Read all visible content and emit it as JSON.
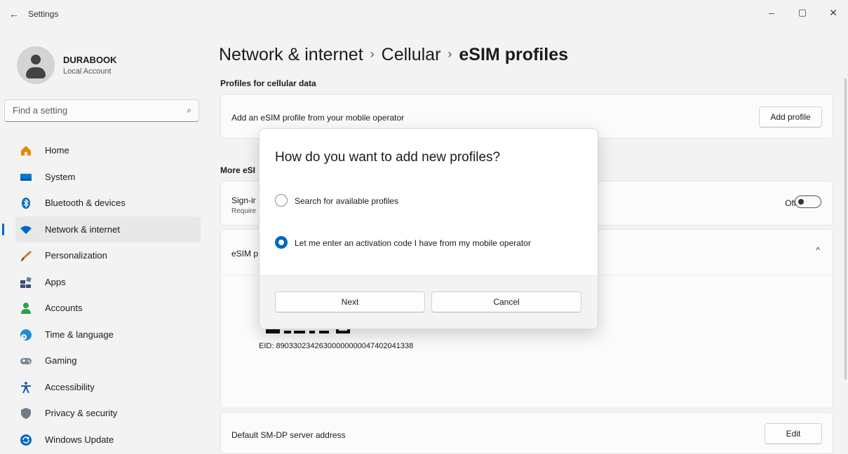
{
  "window": {
    "title": "Settings",
    "controls": [
      "–",
      "▢",
      "✕"
    ]
  },
  "account": {
    "name": "DURABOOK",
    "type": "Local Account"
  },
  "search": {
    "placeholder": "Find a setting"
  },
  "nav": {
    "items": [
      {
        "label": "Home",
        "icon": "home-icon",
        "color": "#e08a00",
        "active": false
      },
      {
        "label": "System",
        "icon": "system-icon",
        "color": "#0078d4",
        "active": false
      },
      {
        "label": "Bluetooth & devices",
        "icon": "bluetooth-icon",
        "color": "#0067c0",
        "active": false
      },
      {
        "label": "Network & internet",
        "icon": "wifi-icon",
        "color": "#0067c0",
        "active": true
      },
      {
        "label": "Personalization",
        "icon": "brush-icon",
        "color": "#c87a2a",
        "active": false
      },
      {
        "label": "Apps",
        "icon": "apps-icon",
        "color": "#3b4f6b",
        "active": false
      },
      {
        "label": "Accounts",
        "icon": "accounts-icon",
        "color": "#2ea043",
        "active": false
      },
      {
        "label": "Time & language",
        "icon": "globe-clock-icon",
        "color": "#1f8dd6",
        "active": false
      },
      {
        "label": "Gaming",
        "icon": "controller-icon",
        "color": "#7a8899",
        "active": false
      },
      {
        "label": "Accessibility",
        "icon": "accessibility-icon",
        "color": "#1a5fb4",
        "active": false
      },
      {
        "label": "Privacy & security",
        "icon": "shield-icon",
        "color": "#6f7b88",
        "active": false
      },
      {
        "label": "Windows Update",
        "icon": "update-icon",
        "color": "#0067c0",
        "active": false
      }
    ]
  },
  "breadcrumb": {
    "part1": "Network & internet",
    "part2": "Cellular",
    "current": "eSIM profiles",
    "separator": "›"
  },
  "main": {
    "profiles_section": "Profiles for cellular data",
    "add_profile_text": "Add an eSIM profile from your mobile operator",
    "add_profile_button": "Add profile",
    "more_section": "More eSI",
    "signin_title": "Sign-ir",
    "signin_sub": "Require",
    "toggle_state": "Off",
    "esim_card_title": "eSIM p",
    "eid": "EID: 89033023426300000000047402041338",
    "default_sm_dp": "Default SM-DP server address",
    "edit_button": "Edit"
  },
  "dialog": {
    "title": "How do you want to add new profiles?",
    "option1": "Search for available profiles",
    "option2": "Let me enter an activation code I have from my mobile operator",
    "selected": 2,
    "next": "Next",
    "cancel": "Cancel"
  },
  "colors": {
    "accent": "#0067c0"
  }
}
